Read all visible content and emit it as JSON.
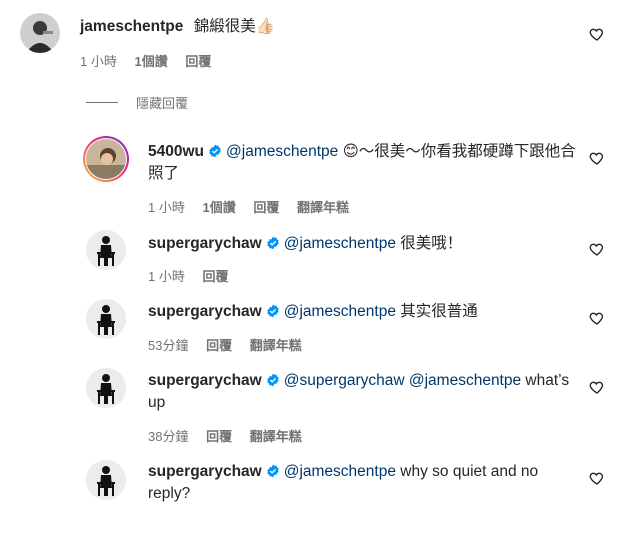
{
  "comments": [
    {
      "username": "jameschentpe",
      "verified": false,
      "mention": "",
      "text": "錦緞很美👍🏻",
      "meta": {
        "time": "1 小時",
        "likes": "1個讚",
        "reply": "回覆",
        "translate": ""
      }
    },
    {
      "username": "5400wu",
      "verified": true,
      "mention": "@jameschentpe",
      "text": "😊～很美～你看我都硬蹲下跟他合照了",
      "meta": {
        "time": "1 小時",
        "likes": "1個讚",
        "reply": "回覆",
        "translate": "翻譯年糕"
      }
    },
    {
      "username": "supergarychaw",
      "verified": true,
      "mention": "@jameschentpe",
      "text": "很美哦！",
      "meta": {
        "time": "1 小時",
        "likes": "",
        "reply": "回覆",
        "translate": ""
      }
    },
    {
      "username": "supergarychaw",
      "verified": true,
      "mention": "@jameschentpe",
      "text": "其实很普通",
      "meta": {
        "time": "53分鐘",
        "likes": "",
        "reply": "回覆",
        "translate": "翻譯年糕"
      }
    },
    {
      "username": "supergarychaw",
      "verified": true,
      "mention": "@supergarychaw @jameschentpe",
      "text": "what’s up",
      "meta": {
        "time": "38分鐘",
        "likes": "",
        "reply": "回覆",
        "translate": "翻譯年糕"
      }
    },
    {
      "username": "supergarychaw",
      "verified": true,
      "mention": "@jameschentpe",
      "text": "why so quiet and no reply?",
      "meta": {
        "time": "",
        "likes": "",
        "reply": "",
        "translate": ""
      }
    }
  ],
  "hide_replies_label": "隱藏回覆",
  "icons": {
    "heart": "heart-outline-icon",
    "verified": "verified-badge-icon"
  },
  "colors": {
    "verified": "#0095f6",
    "mention": "#00376b",
    "meta": "#737373"
  }
}
